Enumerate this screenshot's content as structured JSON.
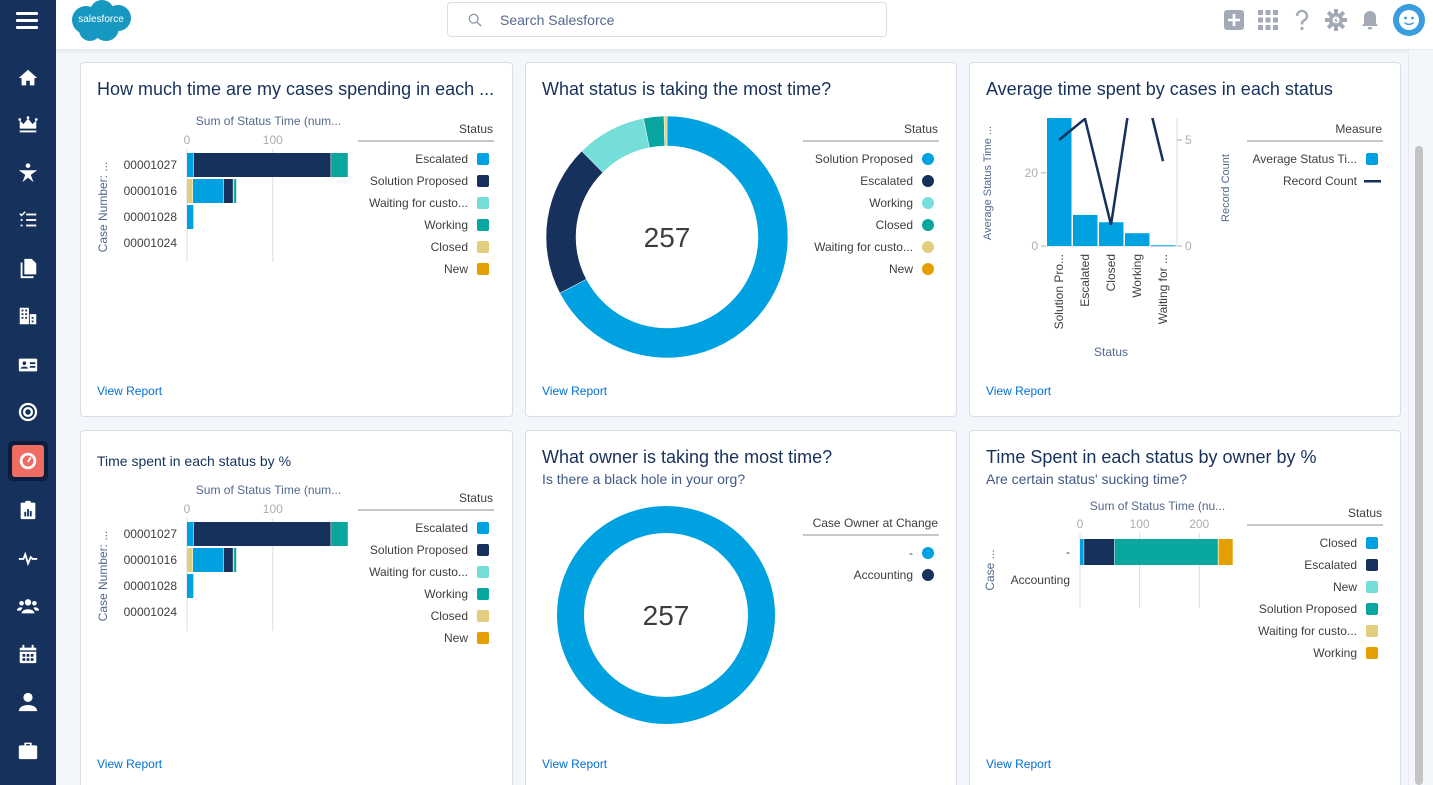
{
  "app": {
    "name": "salesforce"
  },
  "header": {
    "search_placeholder": "Search Salesforce",
    "icons": [
      "add-icon",
      "app-launcher-icon",
      "help-icon",
      "setup-gear-icon",
      "notifications-bell-icon",
      "user-avatar"
    ]
  },
  "sidebar": {
    "items": [
      {
        "name": "home",
        "icon": "home-icon"
      },
      {
        "name": "opportunities",
        "icon": "crown-icon"
      },
      {
        "name": "leads",
        "icon": "person-star-icon"
      },
      {
        "name": "tasks",
        "icon": "task-list-icon"
      },
      {
        "name": "files",
        "icon": "files-icon"
      },
      {
        "name": "accounts",
        "icon": "building-icon"
      },
      {
        "name": "contacts",
        "icon": "contact-card-icon"
      },
      {
        "name": "campaigns",
        "icon": "target-icon"
      },
      {
        "name": "dashboards",
        "icon": "dashboard-gauge-icon",
        "active": true
      },
      {
        "name": "reports",
        "icon": "report-clipboard-icon"
      },
      {
        "name": "feed",
        "icon": "pulse-icon"
      },
      {
        "name": "groups",
        "icon": "groups-icon"
      },
      {
        "name": "calendar",
        "icon": "calendar-icon"
      },
      {
        "name": "people",
        "icon": "person-icon"
      },
      {
        "name": "cases",
        "icon": "briefcase-icon"
      }
    ]
  },
  "colors": {
    "c1": "#00a1e0",
    "c2": "#16325c",
    "c3": "#76ded9",
    "c4": "#08a69e",
    "c5": "#e2ce7d",
    "c6": "#e69f00"
  },
  "cards": [
    {
      "title": "How much time are my cases spending in each ...",
      "view_report": "View Report"
    },
    {
      "title": "What status is taking the most time?",
      "view_report": "View Report"
    },
    {
      "title": "Average time spent by cases in each status",
      "view_report": "View Report"
    },
    {
      "title": "Time spent in each status by %",
      "view_report": "View Report"
    },
    {
      "title": "What owner is taking the most time?",
      "subtitle": "Is there a black hole in your org?",
      "view_report": "View Report"
    },
    {
      "title": "Time Spent in each status by owner by %",
      "subtitle": "Are certain status' sucking time?",
      "view_report": "View Report"
    }
  ],
  "chart_data": [
    {
      "type": "bar",
      "orientation": "horizontal-stacked",
      "xlabel": "Sum of Status Time (num...",
      "ylabel": "Case Number: ...",
      "xticks": [
        "0",
        "100"
      ],
      "xlim": [
        0,
        190
      ],
      "categories": [
        "00001027",
        "00001016",
        "00001028",
        "00001024"
      ],
      "legend_title": "Status",
      "series": [
        {
          "name": "Closed",
          "color": "#e2ce7d",
          "values": [
            0,
            7,
            0,
            0
          ]
        },
        {
          "name": "Escalated",
          "color": "#00a1e0",
          "values": [
            8,
            36,
            8,
            0
          ]
        },
        {
          "name": "Solution Proposed",
          "color": "#16325c",
          "values": [
            160,
            11,
            0,
            0
          ]
        },
        {
          "name": "Waiting for custo...",
          "color": "#76ded9",
          "values": [
            0,
            1,
            0,
            0
          ]
        },
        {
          "name": "Working",
          "color": "#08a69e",
          "values": [
            20,
            3,
            0,
            0
          ]
        },
        {
          "name": "New",
          "color": "#e69f00",
          "values": [
            0,
            0,
            0,
            0
          ]
        }
      ],
      "legend": [
        "Escalated",
        "Solution Proposed",
        "Waiting for custo...",
        "Working",
        "Closed",
        "New"
      ],
      "legend_position": "right"
    },
    {
      "type": "pie",
      "donut": true,
      "center_label": "257",
      "legend_title": "Status",
      "slices": [
        {
          "name": "Solution Proposed",
          "color": "#00a1e0",
          "value": 173
        },
        {
          "name": "Escalated",
          "color": "#16325c",
          "value": 52
        },
        {
          "name": "Working",
          "color": "#76ded9",
          "value": 24
        },
        {
          "name": "Closed",
          "color": "#08a69e",
          "value": 7
        },
        {
          "name": "Waiting for custo...",
          "color": "#e2ce7d",
          "value": 1
        },
        {
          "name": "New",
          "color": "#e69f00",
          "value": 0
        }
      ],
      "legend_position": "right"
    },
    {
      "type": "bar",
      "combo": "bar+line",
      "xlabel": "Status",
      "ylabel": "Average Status Time ...",
      "y2label": "Record Count",
      "categories": [
        "Solution Pro...",
        "Escalated",
        "Closed",
        "Working",
        "Waiting for ..."
      ],
      "yticks": [
        "0",
        "20"
      ],
      "ylim": [
        0,
        35
      ],
      "y2ticks": [
        "0",
        "5"
      ],
      "y2lim": [
        0,
        6
      ],
      "legend_title": "Measure",
      "series": [
        {
          "name": "Average Status Ti...",
          "type": "bar",
          "color": "#00a1e0",
          "values": [
            35,
            8.5,
            6.5,
            3.5,
            0.2
          ]
        },
        {
          "name": "Record Count",
          "type": "line",
          "color": "#16325c",
          "values": [
            5,
            6,
            1,
            9,
            4
          ]
        }
      ],
      "legend_position": "right"
    },
    {
      "type": "bar",
      "orientation": "horizontal-stacked",
      "xlabel": "Sum of Status Time (num...",
      "ylabel": "Case Number: ...",
      "xticks": [
        "0",
        "100"
      ],
      "xlim": [
        0,
        190
      ],
      "categories": [
        "00001027",
        "00001016",
        "00001028",
        "00001024"
      ],
      "legend_title": "Status",
      "series": [
        {
          "name": "Closed",
          "color": "#e2ce7d",
          "values": [
            0,
            7,
            0,
            0
          ]
        },
        {
          "name": "Escalated",
          "color": "#00a1e0",
          "values": [
            8,
            36,
            8,
            0
          ]
        },
        {
          "name": "Solution Proposed",
          "color": "#16325c",
          "values": [
            160,
            11,
            0,
            0
          ]
        },
        {
          "name": "Waiting for custo...",
          "color": "#76ded9",
          "values": [
            0,
            1,
            0,
            0
          ]
        },
        {
          "name": "Working",
          "color": "#08a69e",
          "values": [
            20,
            3,
            0,
            0
          ]
        },
        {
          "name": "New",
          "color": "#e69f00",
          "values": [
            0,
            0,
            0,
            0
          ]
        }
      ],
      "legend": [
        "Escalated",
        "Solution Proposed",
        "Waiting for custo...",
        "Working",
        "Closed",
        "New"
      ],
      "legend_position": "right"
    },
    {
      "type": "pie",
      "donut": true,
      "center_label": "257",
      "legend_title": "Case Owner at Change",
      "slices": [
        {
          "name": "-",
          "color": "#00a1e0",
          "value": 257
        },
        {
          "name": "Accounting",
          "color": "#16325c",
          "value": 0
        }
      ],
      "legend_position": "right"
    },
    {
      "type": "bar",
      "orientation": "horizontal-stacked",
      "xlabel": "Sum of Status Time (nu...",
      "ylabel": "Case ...",
      "xticks": [
        "0",
        "100",
        "200"
      ],
      "xlim": [
        0,
        260
      ],
      "categories": [
        "-",
        "Accounting"
      ],
      "legend_title": "Status",
      "series": [
        {
          "name": "Closed",
          "color": "#00a1e0",
          "values": [
            7,
            0
          ]
        },
        {
          "name": "Escalated",
          "color": "#16325c",
          "values": [
            51,
            0
          ]
        },
        {
          "name": "New",
          "color": "#76ded9",
          "values": [
            0,
            0
          ]
        },
        {
          "name": "Solution Proposed",
          "color": "#08a69e",
          "values": [
            174,
            0
          ]
        },
        {
          "name": "Waiting for custo...",
          "color": "#e2ce7d",
          "values": [
            1,
            0
          ]
        },
        {
          "name": "Working",
          "color": "#e69f00",
          "values": [
            24,
            0
          ]
        }
      ],
      "legend": [
        "Closed",
        "Escalated",
        "New",
        "Solution Proposed",
        "Waiting for custo...",
        "Working"
      ],
      "legend_position": "right"
    }
  ]
}
